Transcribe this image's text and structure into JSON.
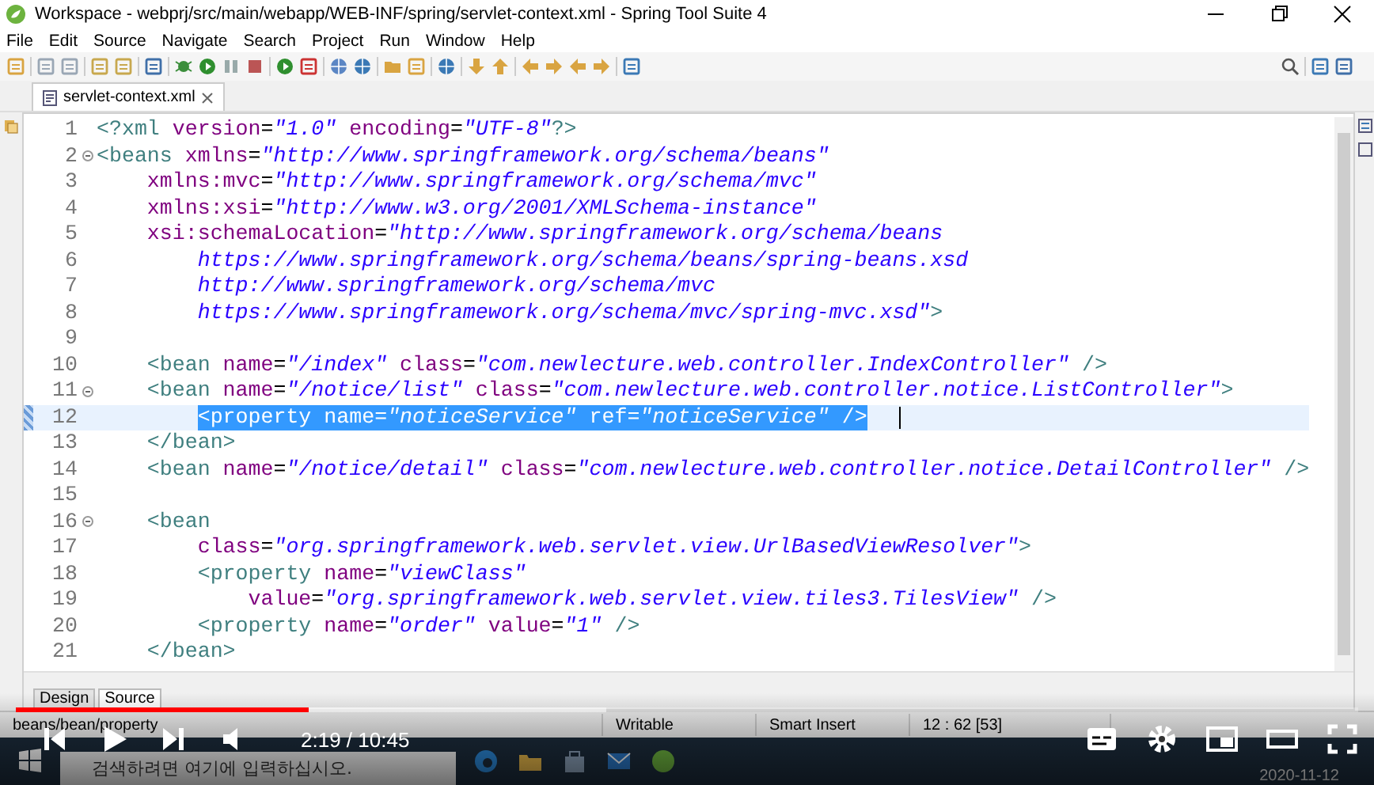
{
  "window": {
    "title": "Workspace - webprj/src/main/webapp/WEB-INF/spring/servlet-context.xml - Spring Tool Suite 4"
  },
  "menu": [
    "File",
    "Edit",
    "Source",
    "Navigate",
    "Search",
    "Project",
    "Run",
    "Window",
    "Help"
  ],
  "editor_tab": {
    "label": "servlet-context.xml",
    "selected": true
  },
  "code_lines": [
    {
      "number": "1",
      "fold_marker": false,
      "selected": false,
      "tokens": [
        {
          "kind": "tag",
          "text": "<?xml"
        },
        {
          "kind": "attr",
          "text": " version"
        },
        {
          "kind": "eq",
          "text": "="
        },
        {
          "kind": "value",
          "text": "\"1.0\""
        },
        {
          "kind": "attr",
          "text": " encoding"
        },
        {
          "kind": "eq",
          "text": "="
        },
        {
          "kind": "value",
          "text": "\"UTF-8\""
        },
        {
          "kind": "tag",
          "text": "?>"
        }
      ]
    },
    {
      "number": "2",
      "fold_marker": true,
      "selected": false,
      "tokens": [
        {
          "kind": "tag",
          "text": "<beans"
        },
        {
          "kind": "attr",
          "text": " xmlns"
        },
        {
          "kind": "eq",
          "text": "="
        },
        {
          "kind": "value",
          "text": "\"http://www.springframework.org/schema/beans\""
        }
      ]
    },
    {
      "number": "3",
      "fold_marker": false,
      "selected": false,
      "tokens": [
        {
          "kind": "attr",
          "text": "    xmlns:mvc"
        },
        {
          "kind": "eq",
          "text": "="
        },
        {
          "kind": "value",
          "text": "\"http://www.springframework.org/schema/mvc\""
        }
      ]
    },
    {
      "number": "4",
      "fold_marker": false,
      "selected": false,
      "tokens": [
        {
          "kind": "attr",
          "text": "    xmlns:xsi"
        },
        {
          "kind": "eq",
          "text": "="
        },
        {
          "kind": "value",
          "text": "\"http://www.w3.org/2001/XMLSchema-instance\""
        }
      ]
    },
    {
      "number": "5",
      "fold_marker": false,
      "selected": false,
      "tokens": [
        {
          "kind": "attr",
          "text": "    xsi:schemaLocation"
        },
        {
          "kind": "eq",
          "text": "="
        },
        {
          "kind": "value",
          "text": "\"http://www.springframework.org/schema/beans"
        }
      ]
    },
    {
      "number": "6",
      "fold_marker": false,
      "selected": false,
      "tokens": [
        {
          "kind": "value",
          "text": "        https://www.springframework.org/schema/beans/spring-beans.xsd"
        }
      ]
    },
    {
      "number": "7",
      "fold_marker": false,
      "selected": false,
      "tokens": [
        {
          "kind": "value",
          "text": "        http://www.springframework.org/schema/mvc"
        }
      ]
    },
    {
      "number": "8",
      "fold_marker": false,
      "selected": false,
      "tokens": [
        {
          "kind": "value",
          "text": "        https://www.springframework.org/schema/mvc/spring-mvc.xsd\""
        },
        {
          "kind": "tag",
          "text": ">"
        }
      ]
    },
    {
      "number": "9",
      "fold_marker": false,
      "selected": false
    },
    {
      "number": "10",
      "fold_marker": false,
      "selected": false,
      "tokens": [
        {
          "kind": "tag",
          "text": "    <bean"
        },
        {
          "kind": "attr",
          "text": " name"
        },
        {
          "kind": "eq",
          "text": "="
        },
        {
          "kind": "value",
          "text": "\"/index\""
        },
        {
          "kind": "attr",
          "text": " class"
        },
        {
          "kind": "eq",
          "text": "="
        },
        {
          "kind": "value",
          "text": "\"com.newlecture.web.controller.IndexController\""
        },
        {
          "kind": "tag",
          "text": " />"
        }
      ]
    },
    {
      "number": "11",
      "fold_marker": true,
      "selected": false,
      "tokens": [
        {
          "kind": "tag",
          "text": "    <bean"
        },
        {
          "kind": "attr",
          "text": " name"
        },
        {
          "kind": "eq",
          "text": "="
        },
        {
          "kind": "value",
          "text": "\"/notice/list\""
        },
        {
          "kind": "attr",
          "text": " class"
        },
        {
          "kind": "eq",
          "text": "="
        },
        {
          "kind": "value",
          "text": "\"com.newlecture.web.controller.notice.ListController\""
        },
        {
          "kind": "tag",
          "text": ">"
        }
      ]
    },
    {
      "number": "12",
      "fold_marker": false,
      "selected": true,
      "tokens": [
        {
          "kind": "tag",
          "text": "<property"
        },
        {
          "kind": "attr",
          "text": " name"
        },
        {
          "kind": "eq",
          "text": "="
        },
        {
          "kind": "value",
          "text": "\"noticeService\""
        },
        {
          "kind": "attr",
          "text": " ref"
        },
        {
          "kind": "eq",
          "text": "="
        },
        {
          "kind": "value",
          "text": "\"noticeService\""
        },
        {
          "kind": "tag",
          "text": " />"
        }
      ]
    },
    {
      "number": "13",
      "fold_marker": false,
      "selected": false,
      "tokens": [
        {
          "kind": "tag",
          "text": "    </bean>"
        }
      ]
    },
    {
      "number": "14",
      "fold_marker": false,
      "selected": false,
      "tokens": [
        {
          "kind": "tag",
          "text": "    <bean"
        },
        {
          "kind": "attr",
          "text": " name"
        },
        {
          "kind": "eq",
          "text": "="
        },
        {
          "kind": "value",
          "text": "\"/notice/detail\""
        },
        {
          "kind": "attr",
          "text": " class"
        },
        {
          "kind": "eq",
          "text": "="
        },
        {
          "kind": "value",
          "text": "\"com.newlecture.web.controller.notice.DetailController\""
        },
        {
          "kind": "tag",
          "text": " />"
        }
      ]
    },
    {
      "number": "15",
      "fold_marker": false,
      "selected": false
    },
    {
      "number": "16",
      "fold_marker": true,
      "selected": false,
      "tokens": [
        {
          "kind": "tag",
          "text": "    <bean"
        }
      ]
    },
    {
      "number": "17",
      "fold_marker": false,
      "selected": false,
      "tokens": [
        {
          "kind": "attr",
          "text": "        class"
        },
        {
          "kind": "eq",
          "text": "="
        },
        {
          "kind": "value",
          "text": "\"org.springframework.web.servlet.view.UrlBasedViewResolver\""
        },
        {
          "kind": "tag",
          "text": ">"
        }
      ]
    },
    {
      "number": "18",
      "fold_marker": false,
      "selected": false,
      "tokens": [
        {
          "kind": "tag",
          "text": "        <property"
        },
        {
          "kind": "attr",
          "text": " name"
        },
        {
          "kind": "eq",
          "text": "="
        },
        {
          "kind": "value",
          "text": "\"viewClass\""
        }
      ]
    },
    {
      "number": "19",
      "fold_marker": false,
      "selected": false,
      "tokens": [
        {
          "kind": "attr",
          "text": "            value"
        },
        {
          "kind": "eq",
          "text": "="
        },
        {
          "kind": "value",
          "text": "\"org.springframework.web.servlet.view.tiles3.TilesView\""
        },
        {
          "kind": "tag",
          "text": " />"
        }
      ]
    },
    {
      "number": "20",
      "fold_marker": false,
      "selected": false,
      "tokens": [
        {
          "kind": "tag",
          "text": "        <property"
        },
        {
          "kind": "attr",
          "text": " name"
        },
        {
          "kind": "eq",
          "text": "="
        },
        {
          "kind": "value",
          "text": "\"order\""
        },
        {
          "kind": "attr",
          "text": " value"
        },
        {
          "kind": "eq",
          "text": "="
        },
        {
          "kind": "value",
          "text": "\"1\""
        },
        {
          "kind": "tag",
          "text": " />"
        }
      ]
    },
    {
      "number": "21",
      "fold_marker": false,
      "selected": false,
      "tokens": [
        {
          "kind": "tag",
          "text": "    </bean>"
        }
      ]
    }
  ],
  "bottom_tabs": [
    {
      "label": "Design",
      "selected": false
    },
    {
      "label": "Source",
      "selected": true
    }
  ],
  "status_bar": {
    "path": "beans/bean/property",
    "mode": "Writable",
    "insert": "Smart Insert",
    "position": "12 : 62 [53]"
  },
  "video_player": {
    "level": 0.218,
    "time": "2:19 / 10:45"
  },
  "taskbar": {
    "search_placeholder": "검색하려면 여기에 입력하십시오.",
    "date": "2020-11-12"
  }
}
